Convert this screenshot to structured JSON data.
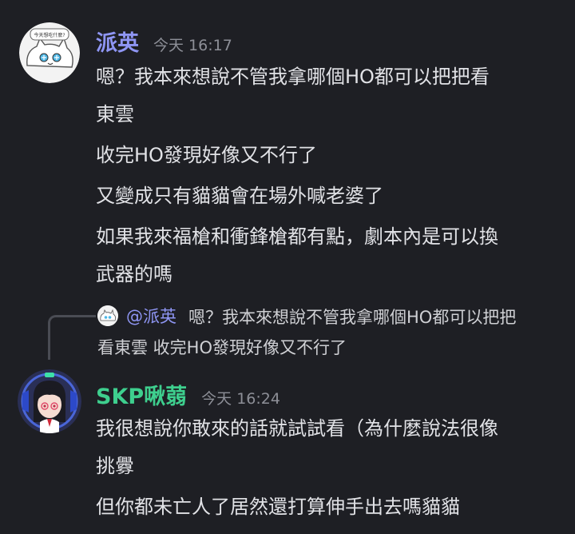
{
  "messages": [
    {
      "author": "派英",
      "author_color": "#8f96f4",
      "timestamp": "今天 16:17",
      "avatar_icon": "cat-avatar-icon",
      "avatar_sticker_text": "今天想吃什麼?",
      "lines": [
        "嗯？我本來想說不管我拿哪個HO都可以把把看",
        "東雲",
        "收完HO發現好像又不行了",
        "又變成只有貓貓會在場外喊老婆了",
        "如果我來福槍和衝鋒槍都有點，劇本內是可以換",
        "武器的嗎"
      ]
    },
    {
      "author": "SKP啾蒻",
      "author_color": "#3ecf8e",
      "timestamp": "今天 16:24",
      "avatar_icon": "anime-girl-avatar-icon",
      "lines": [
        "我很想說你敢來的話就試試看（為什麼說法很像",
        "挑釁",
        "但你都未亡人了居然還打算伸手出去嗎貓貓"
      ]
    }
  ],
  "reply": {
    "author": "@派英",
    "text_line1": "嗯？我本來想說不管我拿哪個HO都可以把把",
    "text_line2": "看東雲 收完HO發現好像又不行了"
  }
}
